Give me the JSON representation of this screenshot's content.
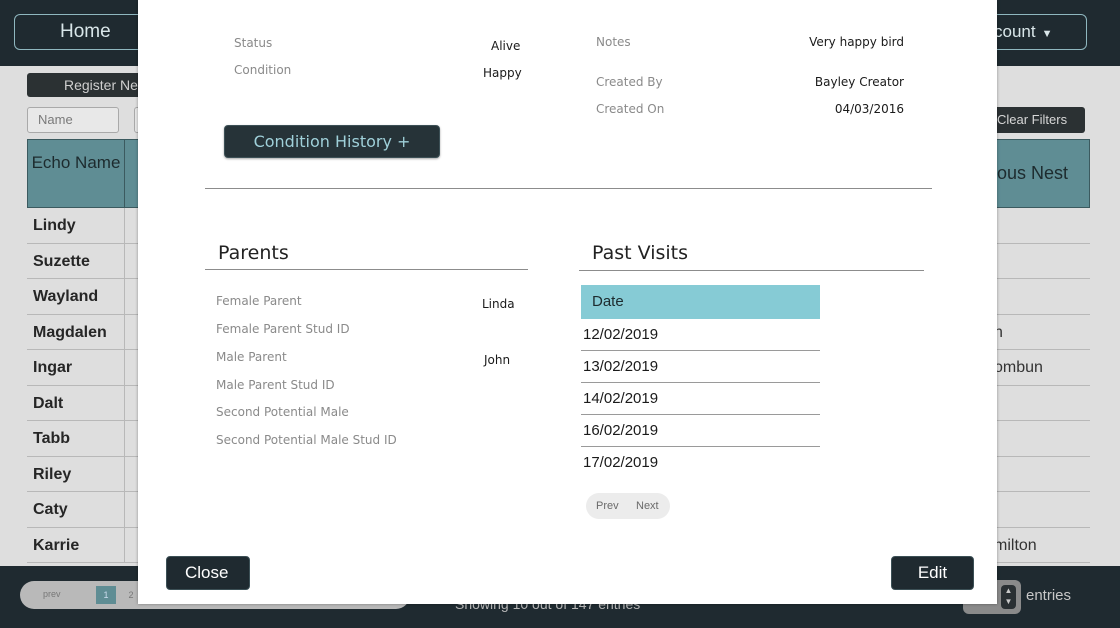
{
  "background": {
    "home_label": "Home",
    "account_label": "count",
    "account_caret": "▼",
    "register_label": "Register Ne",
    "name_filter_label": "Name",
    "clear_filters_label": "Clear Filters",
    "col_echo_name": "Echo Name",
    "col_nest": "ous Nest",
    "rows": [
      {
        "name": "Lindy",
        "nest": ""
      },
      {
        "name": "Suzette",
        "nest": ""
      },
      {
        "name": "Wayland",
        "nest": ""
      },
      {
        "name": "Magdalen",
        "nest": "n"
      },
      {
        "name": "Ingar",
        "nest": "ombun"
      },
      {
        "name": "Dalt",
        "nest": ""
      },
      {
        "name": "Tabb",
        "nest": ""
      },
      {
        "name": "Riley",
        "nest": ""
      },
      {
        "name": "Caty",
        "nest": ""
      },
      {
        "name": "Karrie",
        "nest": "milton"
      }
    ],
    "pager_prev": "prev",
    "pager_page1": "1",
    "pager_page2": "2",
    "showing_text": "Showing 10 out of 147 entries",
    "entries_label": "entries"
  },
  "modal": {
    "status_label": "Status",
    "status_value": "Alive",
    "condition_label": "Condition",
    "condition_value": "Happy",
    "notes_label": "Notes",
    "notes_value": "Very happy bird",
    "created_by_label": "Created By",
    "created_by_value": "Bayley Creator",
    "created_on_label": "Created On",
    "created_on_value": "04/03/2016",
    "condition_history_button": "Condition History +",
    "parents_title": "Parents",
    "parents": [
      {
        "label": "Female Parent",
        "value": "Linda"
      },
      {
        "label": "Female Parent Stud ID",
        "value": ""
      },
      {
        "label": "Male Parent",
        "value": "John"
      },
      {
        "label": "Male Parent Stud ID",
        "value": ""
      },
      {
        "label": "Second Potential Male",
        "value": ""
      },
      {
        "label": "Second Potential Male Stud ID",
        "value": ""
      }
    ],
    "past_visits_title": "Past Visits",
    "visits_header": "Date",
    "visits": [
      "12/02/2019",
      "13/02/2019",
      "14/02/2019",
      "16/02/2019",
      "17/02/2019"
    ],
    "prev_label": "Prev",
    "next_label": "Next",
    "close_label": "Close",
    "edit_label": "Edit"
  },
  "colors": {
    "header_teal": "#86cbd5",
    "dark_button": "#1f2a30",
    "button_text_teal": "#9fd0d9"
  }
}
